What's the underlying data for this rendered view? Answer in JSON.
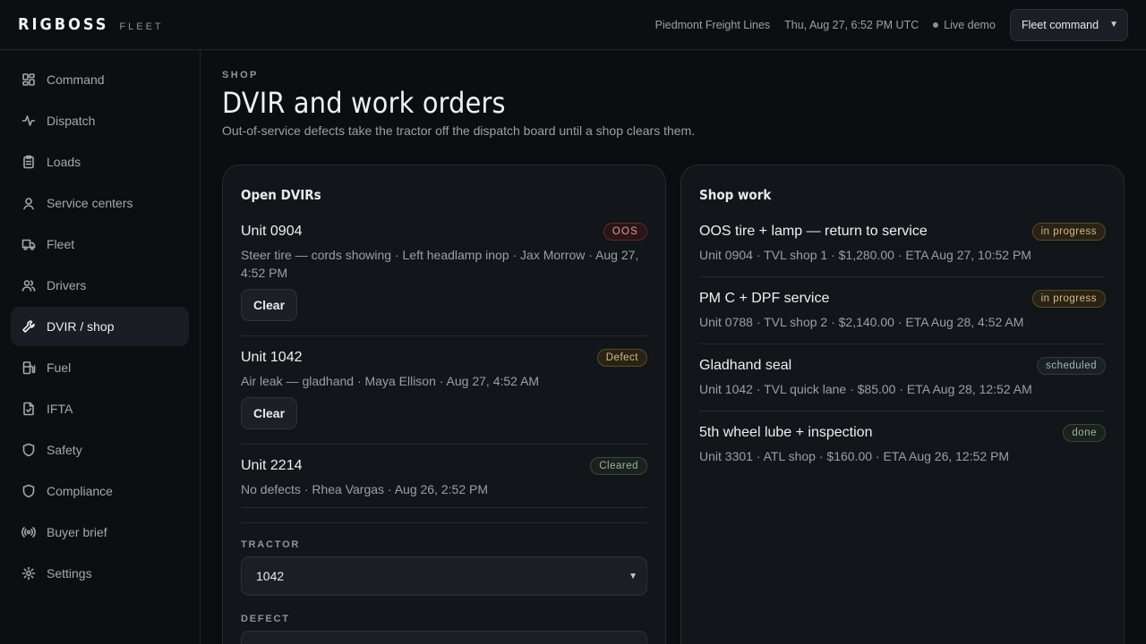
{
  "brand": {
    "name": "RIGBOSS",
    "sub": "FLEET"
  },
  "top": {
    "company": "Piedmont Freight Lines",
    "datetime": "Thu, Aug 27, 6:52 PM UTC",
    "live_label": "Live demo",
    "fleet_select": "Fleet command"
  },
  "sidebar": {
    "items": [
      {
        "label": "Command",
        "icon": "grid-icon"
      },
      {
        "label": "Dispatch",
        "icon": "activity-icon"
      },
      {
        "label": "Loads",
        "icon": "clipboard-icon"
      },
      {
        "label": "Service centers",
        "icon": "map-pin-icon"
      },
      {
        "label": "Fleet",
        "icon": "truck-icon"
      },
      {
        "label": "Drivers",
        "icon": "users-icon"
      },
      {
        "label": "DVIR / shop",
        "icon": "wrench-icon",
        "active": true
      },
      {
        "label": "Fuel",
        "icon": "fuel-icon"
      },
      {
        "label": "IFTA",
        "icon": "file-check-icon"
      },
      {
        "label": "Safety",
        "icon": "shield-icon"
      },
      {
        "label": "Compliance",
        "icon": "shield-icon"
      },
      {
        "label": "Buyer brief",
        "icon": "radio-icon"
      },
      {
        "label": "Settings",
        "icon": "gear-icon"
      }
    ]
  },
  "page": {
    "eyebrow": "SHOP",
    "title": "DVIR and work orders",
    "subtitle": "Out-of-service defects take the tractor off the dispatch board until a shop clears them."
  },
  "dvirs": {
    "title": "Open DVIRs",
    "items": [
      {
        "unit": "Unit 0904",
        "badge": "OOS",
        "meta": "Steer tire — cords showing · Left headlamp inop · Jax Morrow · Aug 27, 4:52 PM",
        "action": "Clear"
      },
      {
        "unit": "Unit 1042",
        "badge": "Defect",
        "meta": "Air leak — gladhand · Maya Ellison · Aug 27, 4:52 AM",
        "action": "Clear"
      },
      {
        "unit": "Unit 2214",
        "badge": "Cleared",
        "meta": "No defects · Rhea Vargas · Aug 26, 2:52 PM"
      }
    ],
    "form": {
      "tractor_label": "TRACTOR",
      "tractor_value": "1042",
      "defect_label": "DEFECT"
    }
  },
  "shop": {
    "title": "Shop work",
    "items": [
      {
        "title": "OOS tire + lamp — return to service",
        "badge": "in progress",
        "meta": "Unit 0904 · TVL shop 1 · $1,280.00 · ETA Aug 27, 10:52 PM"
      },
      {
        "title": "PM C + DPF service",
        "badge": "in progress",
        "meta": "Unit 0788 · TVL shop 2 · $2,140.00 · ETA Aug 28, 4:52 AM"
      },
      {
        "title": "Gladhand seal",
        "badge": "scheduled",
        "meta": "Unit 1042 · TVL quick lane · $85.00 · ETA Aug 28, 12:52 AM"
      },
      {
        "title": "5th wheel lube + inspection",
        "badge": "done",
        "meta": "Unit 3301 · ATL shop · $160.00 · ETA Aug 26, 12:52 PM"
      }
    ]
  }
}
